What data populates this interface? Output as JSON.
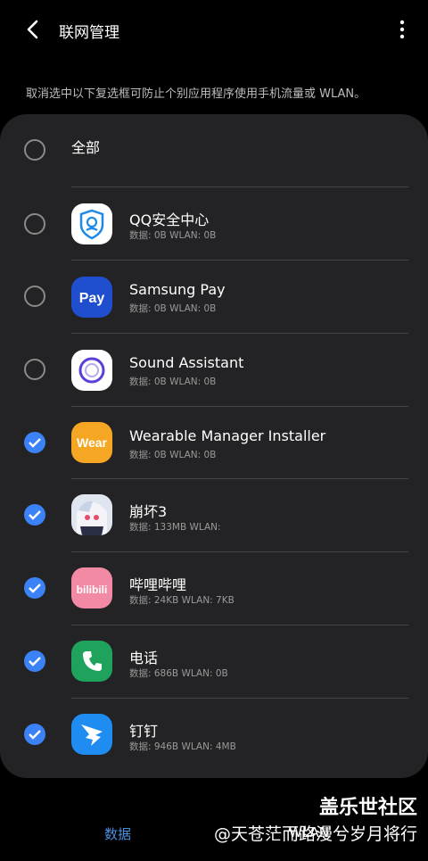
{
  "header": {
    "title": "联网管理"
  },
  "description": "取消选中以下复选框可防止个别应用程序使用手机流量或 WLAN。",
  "select_all": {
    "label": "全部",
    "checked": false
  },
  "apps": [
    {
      "name": "QQ安全中心",
      "usage": "数据: 0B  WLAN: 0B",
      "checked": false,
      "icon": "qq-security-icon",
      "color": "#ffffff"
    },
    {
      "name": "Samsung Pay",
      "usage": "数据: 0B  WLAN: 0B",
      "checked": false,
      "icon": "samsung-pay-icon",
      "color": "#1f4fcf"
    },
    {
      "name": "Sound Assistant",
      "usage": "数据: 0B  WLAN: 0B",
      "checked": false,
      "icon": "sound-assistant-icon",
      "color": "#ffffff"
    },
    {
      "name": "Wearable Manager Installer",
      "usage": "数据: 0B  WLAN: 0B",
      "checked": true,
      "icon": "wear-icon",
      "color": "#f5a623"
    },
    {
      "name": "崩坏3",
      "usage": "数据: 133MB  WLAN:",
      "checked": true,
      "icon": "honkai3-icon",
      "color": "#dfe6f0"
    },
    {
      "name": "哔哩哔哩",
      "usage": "数据: 24KB  WLAN: 7KB",
      "checked": true,
      "icon": "bilibili-icon",
      "color": "#f28aa6"
    },
    {
      "name": "电话",
      "usage": "数据: 686B  WLAN: 0B",
      "checked": true,
      "icon": "phone-icon",
      "color": "#1fa35c"
    },
    {
      "name": "钉钉",
      "usage": "数据: 946B  WLAN: 4MB",
      "checked": true,
      "icon": "dingtalk-icon",
      "color": "#1e8cf0"
    }
  ],
  "tabs": [
    {
      "label": "数据",
      "active": true
    },
    {
      "label": "WLAN",
      "active": false
    }
  ],
  "watermark": {
    "line1": "盖乐世社区",
    "line2": "@天苍茫而路漫兮岁月将行"
  },
  "colors": {
    "accent": "#3b82f6",
    "card": "#232325",
    "tab_active": "#4a90e2"
  }
}
